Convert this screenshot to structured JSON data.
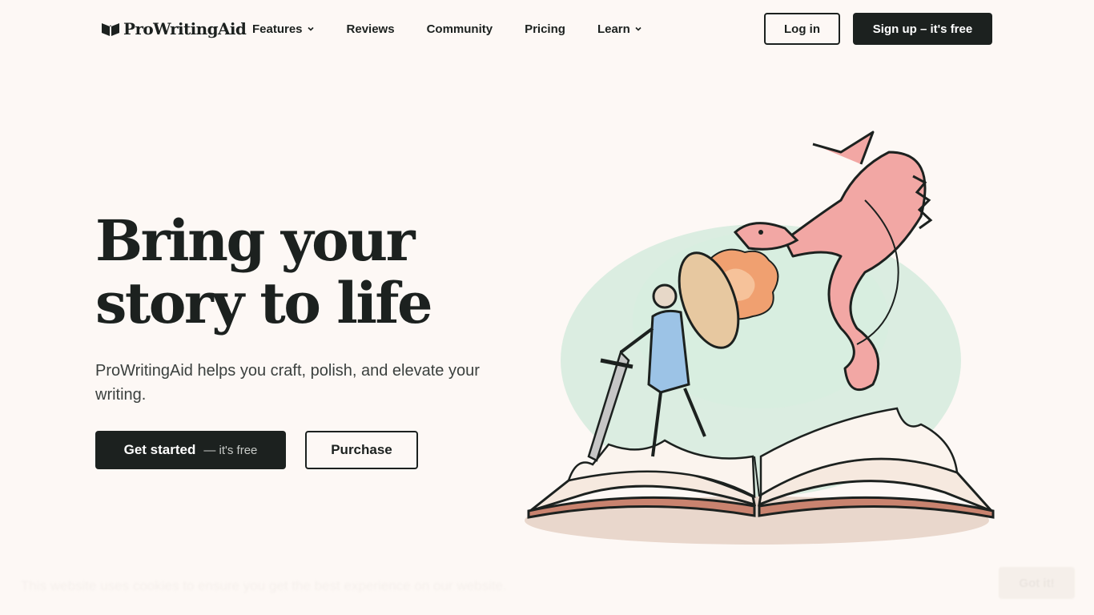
{
  "brand": {
    "name": "ProWritingAid"
  },
  "nav": {
    "items": [
      {
        "label": "Features",
        "has_dropdown": true
      },
      {
        "label": "Reviews",
        "has_dropdown": false
      },
      {
        "label": "Community",
        "has_dropdown": false
      },
      {
        "label": "Pricing",
        "has_dropdown": false
      },
      {
        "label": "Learn",
        "has_dropdown": true
      }
    ],
    "login_label": "Log in",
    "signup_label": "Sign up – it's free"
  },
  "hero": {
    "title_line1": "Bring your",
    "title_line2": "story to life",
    "subtitle": "ProWritingAid helps you craft, polish, and elevate your writing.",
    "cta_primary": "Get started",
    "cta_primary_aside": "— it's free",
    "cta_secondary": "Purchase"
  },
  "illustration": {
    "description_icon": "book-dragon-knight-illustration"
  },
  "cookie_bar": {
    "text": "This website uses cookies to ensure you get the best experience on our website.",
    "button": "Got it!"
  },
  "colors": {
    "background": "#fdf8f5",
    "ink": "#1c211f",
    "dragon": "#f2a7a4",
    "dress": "#9cc3e6",
    "glow": "#bfe3cf",
    "fire": "#f0a070"
  }
}
